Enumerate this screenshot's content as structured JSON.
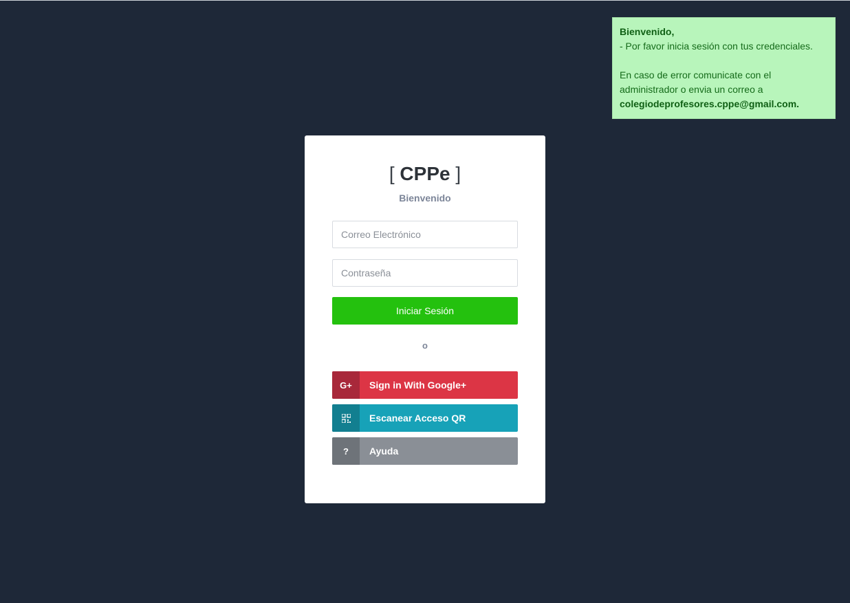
{
  "notice": {
    "greeting": "Bienvenido,",
    "line1": "- Por favor inicia sesión con tus credenciales.",
    "line2": "En caso de error comunicate con el administrador o envia un correo a",
    "email": "colegiodeprofesores.cppe@gmail.com."
  },
  "login": {
    "brand_open": "[",
    "brand_name": "CPPe",
    "brand_close": "]",
    "subtitle": "Bienvenido",
    "email_placeholder": "Correo Electrónico",
    "password_placeholder": "Contraseña",
    "submit_label": "Iniciar Sesión",
    "or_label": "o"
  },
  "social": {
    "google": {
      "icon": "G+",
      "label": "Sign in With Google+",
      "color": "#dc3545"
    },
    "qr": {
      "icon": "qr-code-icon",
      "label": "Escanear Acceso QR",
      "color": "#17a2b8"
    },
    "help": {
      "icon": "?",
      "label": "Ayuda",
      "color": "#8a8f96"
    }
  },
  "colors": {
    "background": "#1e2838",
    "submit": "#24c10e",
    "notice_bg": "#b8f5bb"
  }
}
